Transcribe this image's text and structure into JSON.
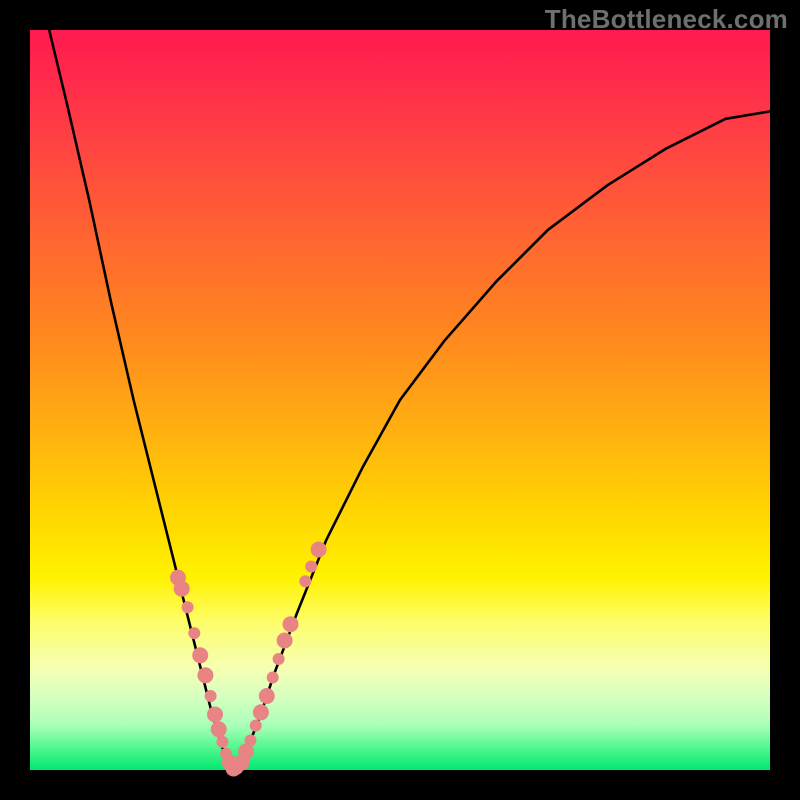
{
  "watermark": "TheBottleneck.com",
  "chart_data": {
    "type": "line",
    "title": "",
    "xlabel": "",
    "ylabel": "",
    "xlim": [
      0,
      1
    ],
    "ylim": [
      0,
      1
    ],
    "grid": false,
    "series": [
      {
        "name": "bottleneck-curve",
        "color": "#000000",
        "x": [
          0.026,
          0.05,
          0.08,
          0.11,
          0.14,
          0.17,
          0.2,
          0.225,
          0.245,
          0.26,
          0.275,
          0.29,
          0.31,
          0.33,
          0.36,
          0.4,
          0.45,
          0.5,
          0.56,
          0.63,
          0.7,
          0.78,
          0.86,
          0.94,
          1.0
        ],
        "y": [
          1.0,
          0.9,
          0.77,
          0.63,
          0.5,
          0.38,
          0.26,
          0.16,
          0.08,
          0.03,
          0.0,
          0.02,
          0.07,
          0.13,
          0.21,
          0.31,
          0.41,
          0.5,
          0.58,
          0.66,
          0.73,
          0.79,
          0.84,
          0.88,
          0.89
        ]
      }
    ],
    "highlight_points": {
      "color": "#e98484",
      "radius_sequence": [
        8,
        8,
        6,
        6,
        8,
        8,
        6,
        8,
        8,
        6,
        6,
        8,
        8,
        6,
        8,
        8,
        6,
        6,
        8,
        8,
        6,
        6,
        8,
        8,
        6,
        6,
        8,
        8
      ],
      "points": [
        [
          0.2,
          0.26
        ],
        [
          0.205,
          0.245
        ],
        [
          0.213,
          0.22
        ],
        [
          0.222,
          0.185
        ],
        [
          0.23,
          0.155
        ],
        [
          0.237,
          0.128
        ],
        [
          0.244,
          0.1
        ],
        [
          0.25,
          0.075
        ],
        [
          0.255,
          0.055
        ],
        [
          0.26,
          0.038
        ],
        [
          0.265,
          0.022
        ],
        [
          0.27,
          0.01
        ],
        [
          0.275,
          0.002
        ],
        [
          0.28,
          0.002
        ],
        [
          0.286,
          0.01
        ],
        [
          0.292,
          0.025
        ],
        [
          0.298,
          0.04
        ],
        [
          0.305,
          0.06
        ],
        [
          0.312,
          0.078
        ],
        [
          0.32,
          0.1
        ],
        [
          0.328,
          0.125
        ],
        [
          0.336,
          0.15
        ],
        [
          0.344,
          0.175
        ],
        [
          0.352,
          0.197
        ],
        [
          0.372,
          0.255
        ],
        [
          0.38,
          0.275
        ],
        [
          0.39,
          0.298
        ]
      ]
    }
  }
}
